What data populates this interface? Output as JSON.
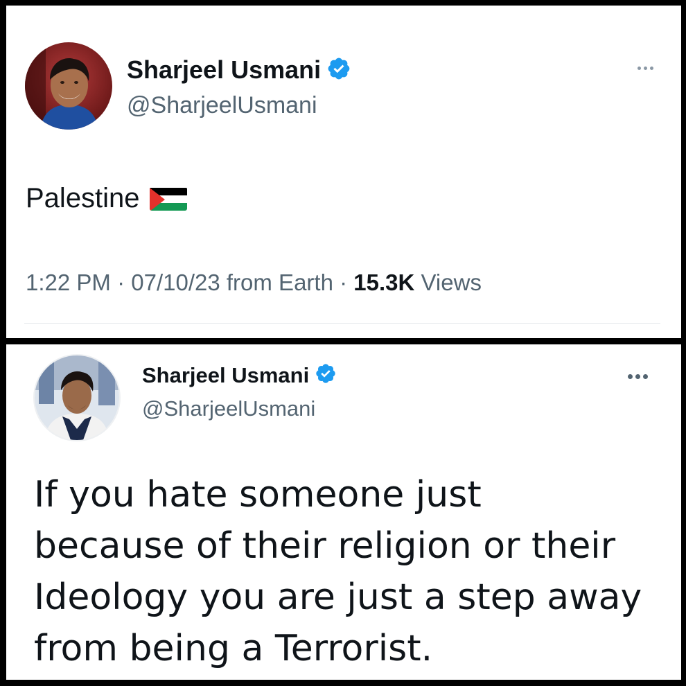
{
  "tweets": [
    {
      "author": {
        "name": "Sharjeel Usmani",
        "handle": "@SharjeelUsmani",
        "verified": true,
        "avatar": "profile-photo-smiling-man-red-background"
      },
      "text": "Palestine",
      "emoji": "palestine-flag",
      "meta": {
        "time": "1:22 PM",
        "sep1": "·",
        "date": "07/10/23",
        "source": "from Earth",
        "sep2": "·",
        "views_count": "15.3K",
        "views_label": "Views"
      }
    },
    {
      "author": {
        "name": "Sharjeel Usmani",
        "handle": "@SharjeelUsmani",
        "verified": true,
        "avatar": "profile-photo-man-with-scarf"
      },
      "text_lines": [
        "If you hate someone just",
        "because of their religion or their",
        "Ideology you are just a step away",
        "from being a Terrorist."
      ]
    }
  ],
  "colors": {
    "verified_blue": "#1d9bf0",
    "secondary_text": "#536471",
    "primary_text": "#0f1419",
    "flag_black": "#000000",
    "flag_green": "#149954",
    "flag_red": "#e4312b"
  },
  "icons": {
    "verified": "verified-badge-icon",
    "more": "more-options-icon"
  }
}
